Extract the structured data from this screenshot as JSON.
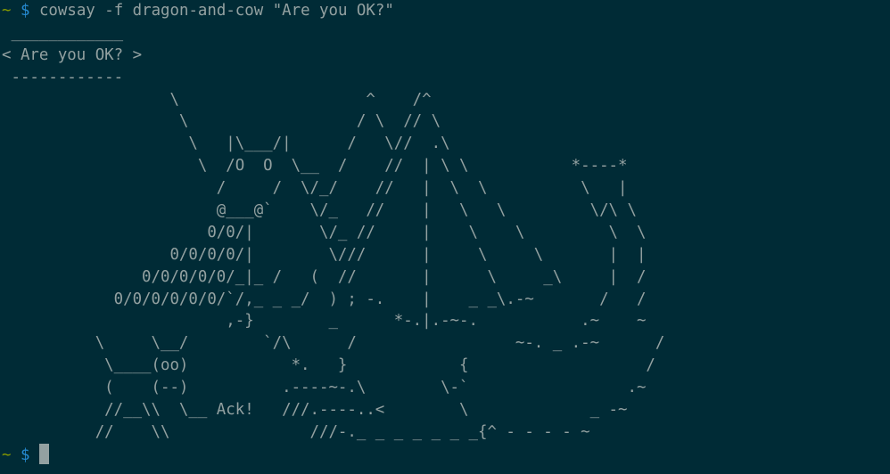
{
  "terminal": {
    "prompt": {
      "tilde": "~",
      "dollar": "$"
    },
    "command": "cowsay -f dragon-and-cow \"Are you OK?\"",
    "output_lines": [
      " ____________",
      "< Are you OK? >",
      " ------------",
      "                  \\                    ^    /^",
      "                   \\                  / \\  // \\",
      "                    \\   |\\___/|      /   \\//  .\\",
      "                     \\  /O  O  \\__  /    //  | \\ \\           *----*",
      "                       /     /  \\/_/    //   |  \\  \\          \\   |",
      "                       @___@`    \\/_   //    |   \\   \\         \\/\\ \\",
      "                      0/0/|       \\/_ //     |    \\    \\         \\  \\",
      "                  0/0/0/0/|        \\///      |     \\     \\       |  |",
      "               0/0/0/0/0/_|_ /   (  //       |      \\     _\\     |  /",
      "            0/0/0/0/0/0/`/,_ _ _/  ) ; -.    |    _ _\\.-~       /   /",
      "                        ,-}        _      *-.|.-~-.           .~    ~",
      "          \\     \\__/        `/\\      /                 ~-. _ .-~      /",
      "           \\____(oo)           *.   }            {                   /",
      "           (    (--)          .----~-.\\        \\-`                 .~",
      "           //__\\\\  \\__ Ack!   ///.----..<        \\             _ -~",
      "          //    \\\\               ///-._ _ _ _ _ _ _{^ - - - - ~"
    ]
  }
}
